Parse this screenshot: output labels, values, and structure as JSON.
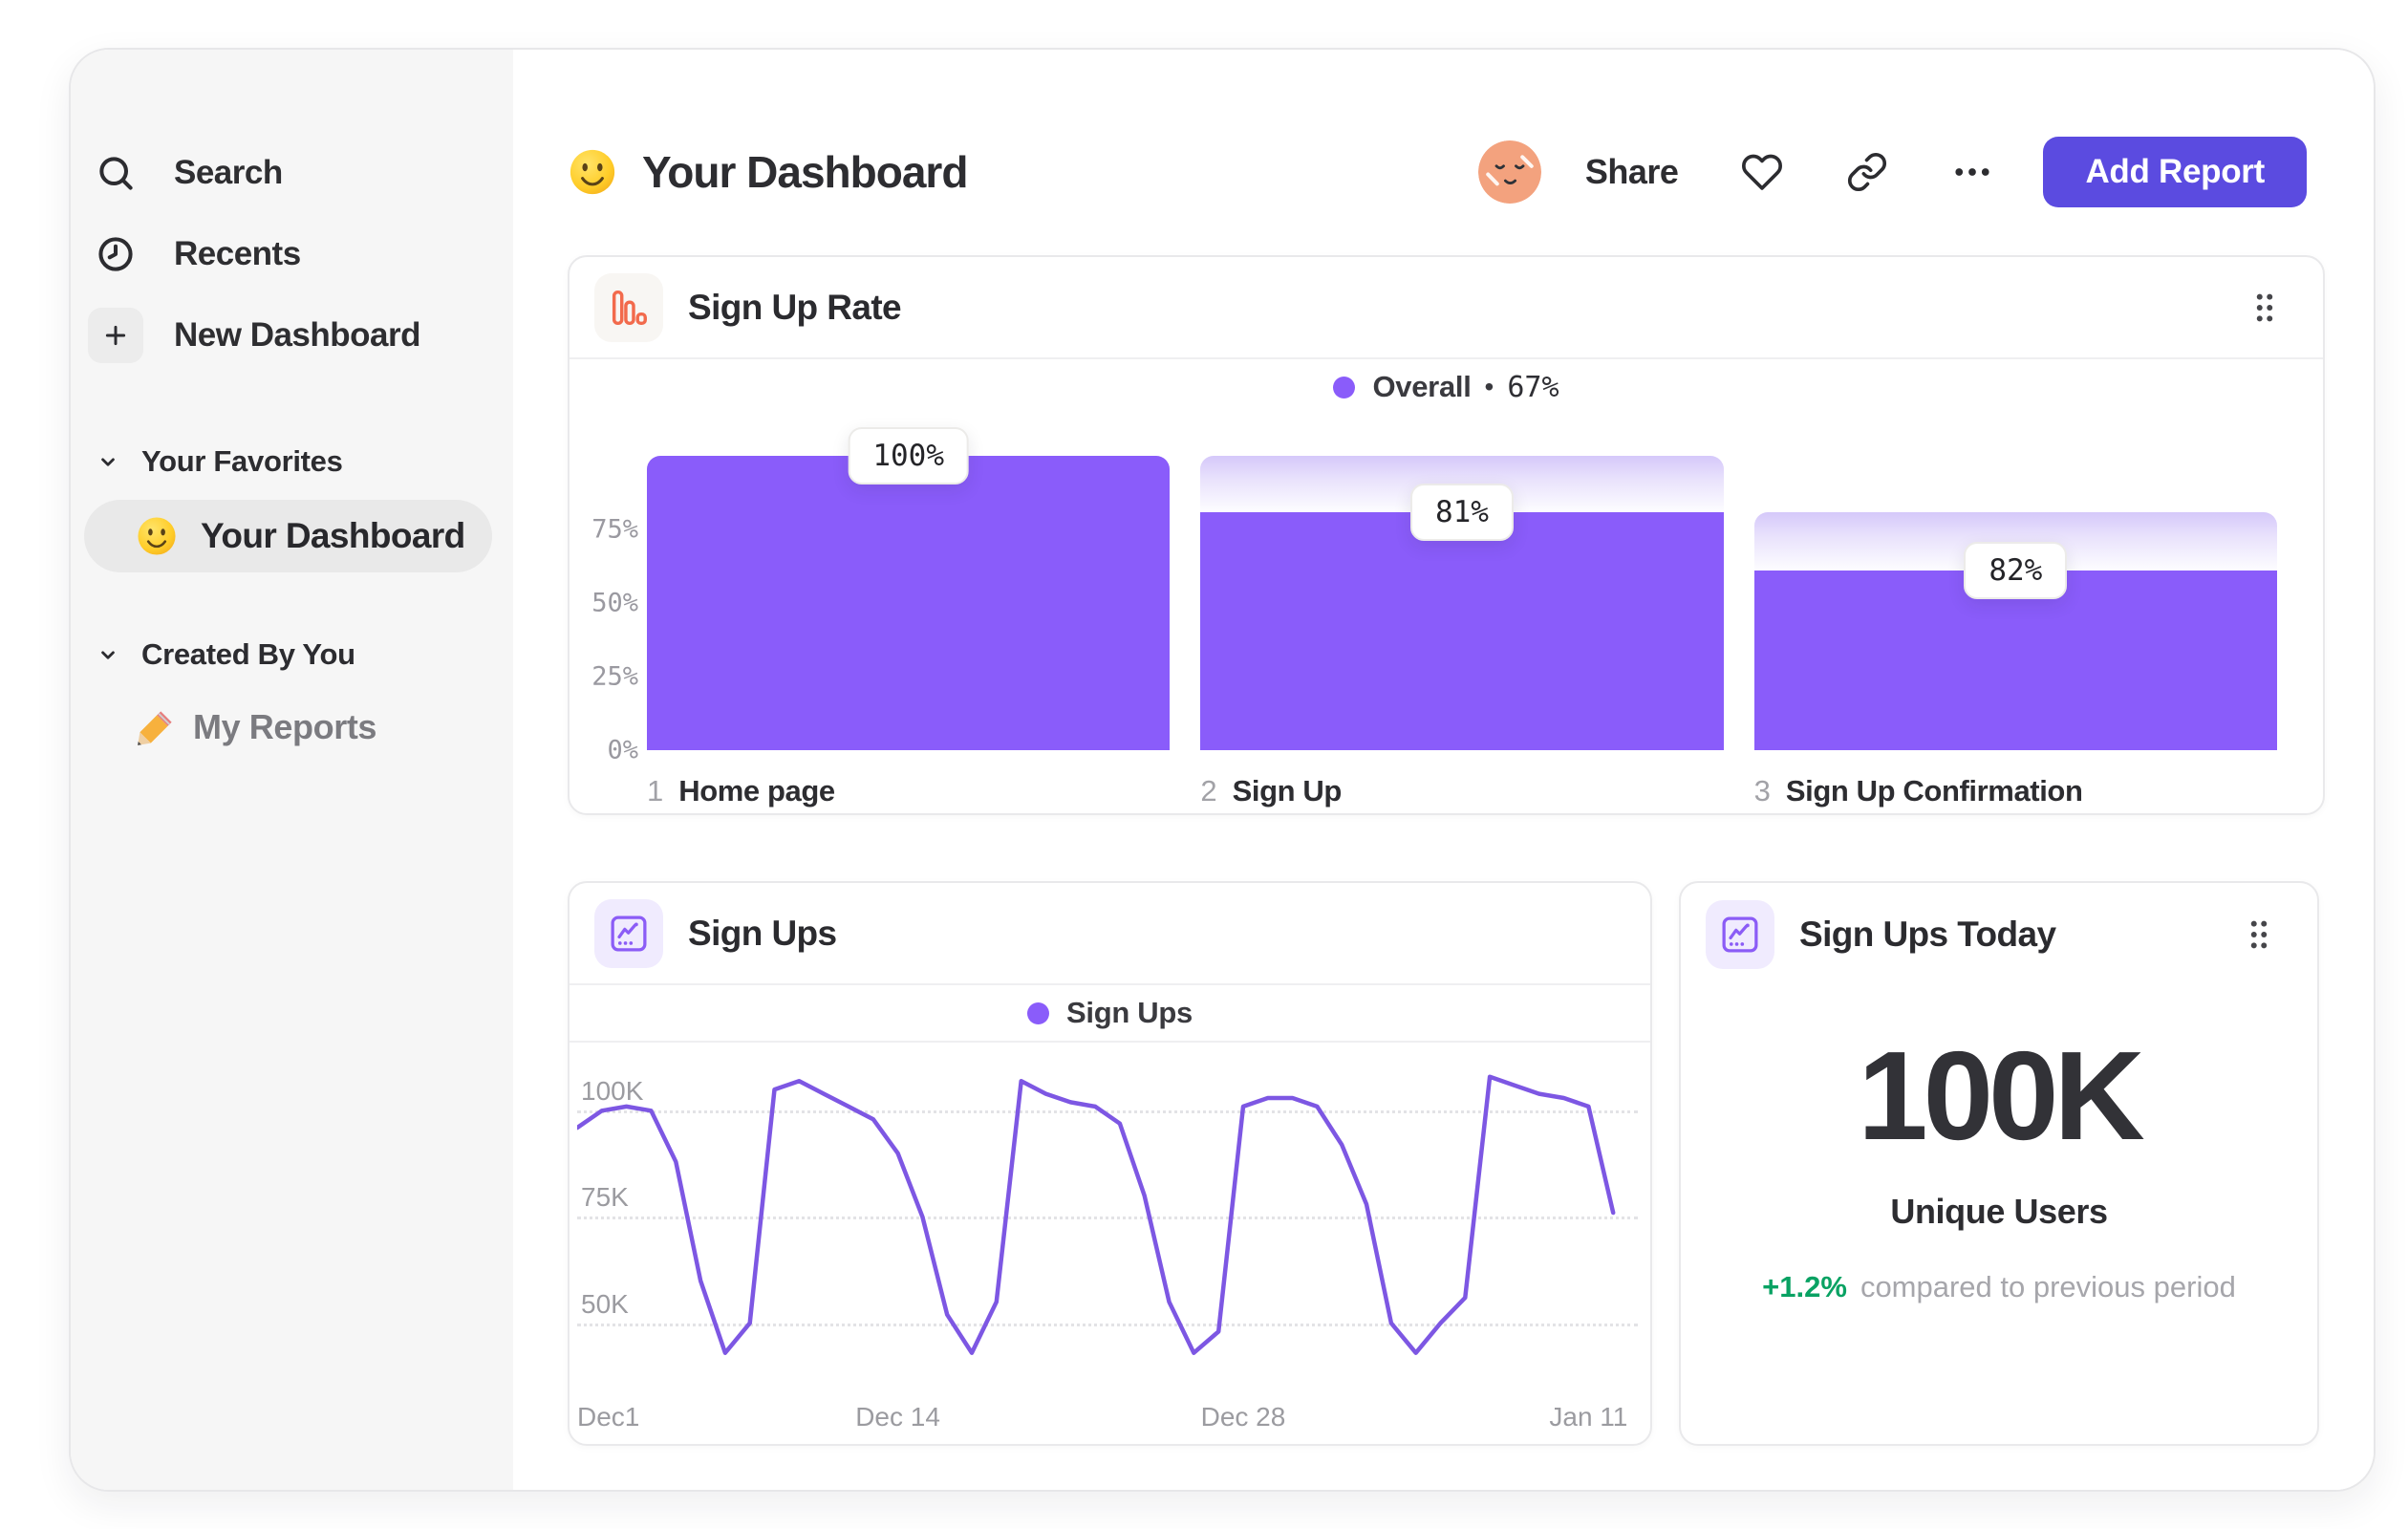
{
  "sidebar": {
    "items": [
      {
        "icon": "search",
        "label": "Search"
      },
      {
        "icon": "clock",
        "label": "Recents"
      },
      {
        "icon": "plus",
        "label": "New Dashboard"
      }
    ],
    "sections": [
      {
        "title": "Your Favorites"
      },
      {
        "title": "Created By You"
      }
    ],
    "favorites_item": "Your Dashboard",
    "reports_item": "My Reports"
  },
  "header": {
    "title": "Your Dashboard",
    "share": "Share",
    "add_report": "Add Report"
  },
  "cards": {
    "funnel": {
      "title": "Sign Up Rate",
      "legend": {
        "label": "Overall",
        "sep": "•",
        "value": "67%"
      },
      "y_ticks": [
        "75%",
        "50%",
        "25%",
        "0%"
      ],
      "steps": [
        {
          "index": "1",
          "label": "Home page",
          "value": "100%"
        },
        {
          "index": "2",
          "label": "Sign Up",
          "value": "81%"
        },
        {
          "index": "3",
          "label": "Sign Up Confirmation",
          "value": "82%"
        }
      ]
    },
    "line": {
      "title": "Sign Ups",
      "legend": "Sign Ups",
      "y_ticks": [
        "100K",
        "75K",
        "50K"
      ],
      "x_ticks": [
        "Dec1",
        "Dec 14",
        "Dec 28",
        "Jan 11"
      ]
    },
    "metric": {
      "title": "Sign Ups Today",
      "value": "100K",
      "label": "Unique Users",
      "delta": "+1.2%",
      "note": "compared to previous period"
    }
  },
  "colors": {
    "accent_purple": "#8a5cfa",
    "line_purple": "#7d57e3",
    "button_indigo": "#5b4be0",
    "icon_coral": "#f26a4c",
    "delta_green": "#09a263"
  },
  "chart_data": [
    {
      "type": "bar",
      "subtype": "funnel",
      "title": "Sign Up Rate",
      "legend": "Overall",
      "overall_conversion_pct": 67,
      "y_axis": {
        "ticks_pct": [
          75,
          50,
          25,
          0
        ],
        "max_pct": 100
      },
      "steps": [
        {
          "step": 1,
          "label": "Home page",
          "conversion_pct": 100,
          "drawn_top_pct": 100,
          "cap_from_pct": 100
        },
        {
          "step": 2,
          "label": "Sign Up",
          "conversion_pct": 81,
          "drawn_top_pct": 81,
          "cap_from_pct": 100
        },
        {
          "step": 3,
          "label": "Sign Up Confirmation",
          "conversion_pct": 82,
          "drawn_top_pct": 61,
          "cap_from_pct": 81
        }
      ]
    },
    {
      "type": "line",
      "title": "Sign Ups",
      "unit": "K",
      "y_grid": [
        100,
        75,
        50
      ],
      "y_min": 40,
      "y_max": 112,
      "x_max_day": 43,
      "x_ticks": [
        {
          "label": "Dec1",
          "day": 0
        },
        {
          "label": "Dec 14",
          "day": 13
        },
        {
          "label": "Dec 28",
          "day": 27
        },
        {
          "label": "Jan 11",
          "day": 41
        }
      ],
      "series": [
        {
          "name": "Sign Ups",
          "points_day_valueK": [
            [
              0,
              96
            ],
            [
              1,
              100
            ],
            [
              2,
              101
            ],
            [
              3,
              100
            ],
            [
              4,
              88
            ],
            [
              5,
              60
            ],
            [
              6,
              43
            ],
            [
              7,
              50
            ],
            [
              8,
              105
            ],
            [
              9,
              107
            ],
            [
              10,
              104
            ],
            [
              11,
              101
            ],
            [
              12,
              98
            ],
            [
              13,
              90
            ],
            [
              14,
              75
            ],
            [
              15,
              52
            ],
            [
              16,
              43
            ],
            [
              17,
              55
            ],
            [
              18,
              107
            ],
            [
              19,
              104
            ],
            [
              20,
              102
            ],
            [
              21,
              101
            ],
            [
              22,
              97
            ],
            [
              23,
              80
            ],
            [
              24,
              55
            ],
            [
              25,
              43
            ],
            [
              26,
              48
            ],
            [
              27,
              101
            ],
            [
              28,
              103
            ],
            [
              29,
              103
            ],
            [
              30,
              101
            ],
            [
              31,
              92
            ],
            [
              32,
              78
            ],
            [
              33,
              50
            ],
            [
              34,
              43
            ],
            [
              35,
              50
            ],
            [
              36,
              56
            ],
            [
              37,
              108
            ],
            [
              38,
              106
            ],
            [
              39,
              104
            ],
            [
              40,
              103
            ],
            [
              41,
              101
            ],
            [
              42,
              76
            ]
          ]
        }
      ]
    },
    {
      "type": "metric",
      "title": "Sign Ups Today",
      "value": "100K",
      "label": "Unique Users",
      "delta_pct": "+1.2%",
      "comparison": "compared to previous period"
    }
  ]
}
